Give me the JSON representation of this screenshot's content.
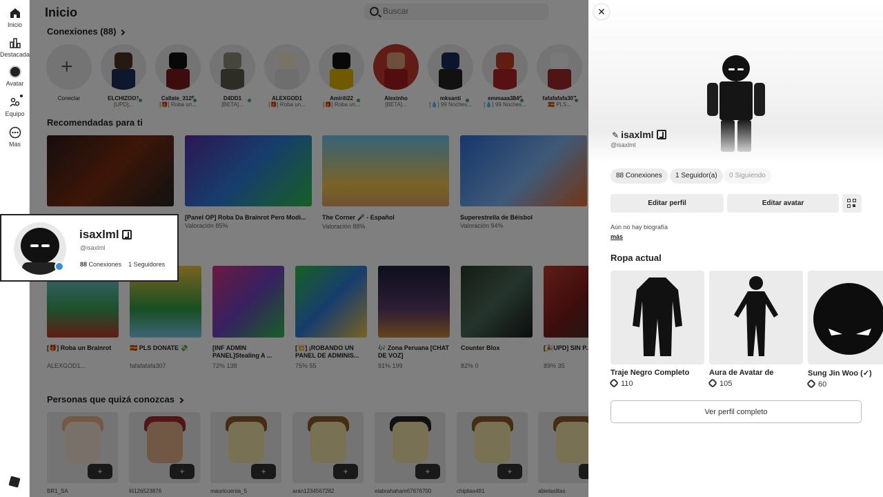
{
  "nav": {
    "items": [
      {
        "label": "Inicio",
        "icon": "home-icon"
      },
      {
        "label": "Destacadas",
        "icon": "chart-icon"
      },
      {
        "label": "Avatar",
        "icon": "avatar-icon"
      },
      {
        "label": "Equipo",
        "icon": "team-icon"
      },
      {
        "label": "Más",
        "icon": "more-icon"
      }
    ]
  },
  "header": {
    "title": "Inicio",
    "search_placeholder": "Buscar"
  },
  "connections": {
    "title": "Conexiones (88)",
    "add_label": "Conectar",
    "items": [
      {
        "name": "ELCHIZOO1",
        "status": "[UPD]..."
      },
      {
        "name": "Callate_3125",
        "status": "[🎁] Roba un..."
      },
      {
        "name": "D4DD1",
        "status": "[BETA]..."
      },
      {
        "name": "ALEXGOD1",
        "status": "[🎁] Roba un..."
      },
      {
        "name": "Amirili22",
        "status": "[🎁] Roba un..."
      },
      {
        "name": "Alexinho",
        "status": "[BETA]..."
      },
      {
        "name": "mksanti",
        "status": "[💧] 99 Noches..."
      },
      {
        "name": "emmaaa3840",
        "status": "[💧] 99 Noches..."
      },
      {
        "name": "fafafafafa307",
        "status": "🇪🇸 PLS..."
      }
    ]
  },
  "recommended": {
    "title": "Recomendadas para ti",
    "items": [
      {
        "title": "",
        "rating": ""
      },
      {
        "title": "[Panel OP] Roba Da Brainrot Pero Modi...",
        "rating": "Valoración 85%"
      },
      {
        "title": "The Corner 🎤 - Español",
        "rating": "Valoración 88%"
      },
      {
        "title": "Superestrella de Béisbol",
        "rating": "Valoración 94%"
      }
    ]
  },
  "games": {
    "items": [
      {
        "title": "[🎁] Roba un Brainrot",
        "meta": "ALEXGOD1..."
      },
      {
        "title": "🇪🇸 PLS DONATE 💸",
        "meta": "fafafafafa307"
      },
      {
        "title": "[INF ADMIN PANEL]Stealing A ...",
        "meta": "72%   138"
      },
      {
        "title": "[💥] ¡ROBANDO UN PANEL DE ADMINIS...",
        "meta": "75%   55"
      },
      {
        "title": "🎶 Zona Peruana [CHAT DE VOZ]",
        "meta": "91%   199"
      },
      {
        "title": "Counter Blox",
        "meta": "82%   0"
      },
      {
        "title": "[🎉UPD] SIN P...",
        "meta": "89%   35"
      }
    ]
  },
  "people": {
    "title": "Personas que quizá conozcas",
    "items": [
      {
        "name": "BR1_SA"
      },
      {
        "name": "lili126523876"
      },
      {
        "name": "mauricuenta_5"
      },
      {
        "name": "aran1234567282"
      },
      {
        "name": "elabrahaham67676700"
      },
      {
        "name": "chipitas481"
      },
      {
        "name": "abielaslitas"
      }
    ]
  },
  "hovercard": {
    "name": "isaxlml",
    "handle": "@isaxlml",
    "connections_count": "88",
    "connections_label": "Conexiones",
    "followers_count": "1",
    "followers_label": "Seguidores"
  },
  "profile": {
    "name": "isaxlml",
    "handle": "@isaxlml",
    "chips": [
      "88 Conexiones",
      "1 Seguidor(a)",
      "0 Siguiendo"
    ],
    "edit_profile": "Editar perfil",
    "edit_avatar": "Editar avatar",
    "bio": "Aún no hay biografía",
    "more": "más",
    "outfit_title": "Ropa actual",
    "outfit": [
      {
        "name": "Traje Negro Completo",
        "price": "110"
      },
      {
        "name": "Aura de Avatar de",
        "price": "105"
      },
      {
        "name": "Sung Jin Woo (✓)",
        "price": "60"
      }
    ],
    "view_full": "Ver perfil completo"
  }
}
